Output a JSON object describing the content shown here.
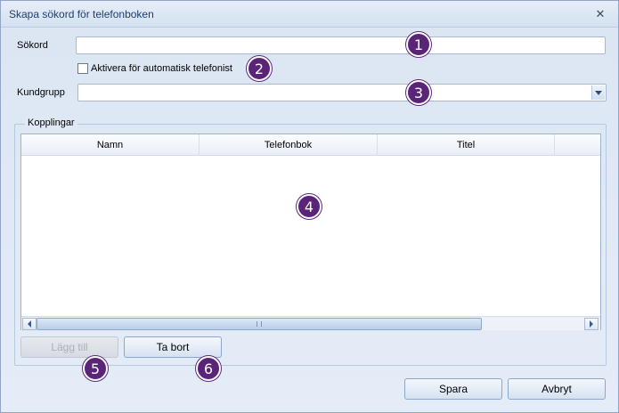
{
  "window": {
    "title": "Skapa sökord för telefonboken"
  },
  "form": {
    "sokord_label": "Sökord",
    "sokord_value": "",
    "checkbox_label": "Aktivera för automatisk telefonist",
    "kundgrupp_label": "Kundgrupp",
    "kundgrupp_value": ""
  },
  "kopplingar": {
    "legend": "Kopplingar",
    "columns": [
      "Namn",
      "Telefonbok",
      "Titel"
    ]
  },
  "buttons": {
    "add": "Lägg till",
    "remove": "Ta bort",
    "save": "Spara",
    "cancel": "Avbryt"
  },
  "badges": [
    "1",
    "2",
    "3",
    "4",
    "5",
    "6"
  ],
  "colors": {
    "badge": "#5a2579",
    "title_text": "#1e3d6e"
  }
}
